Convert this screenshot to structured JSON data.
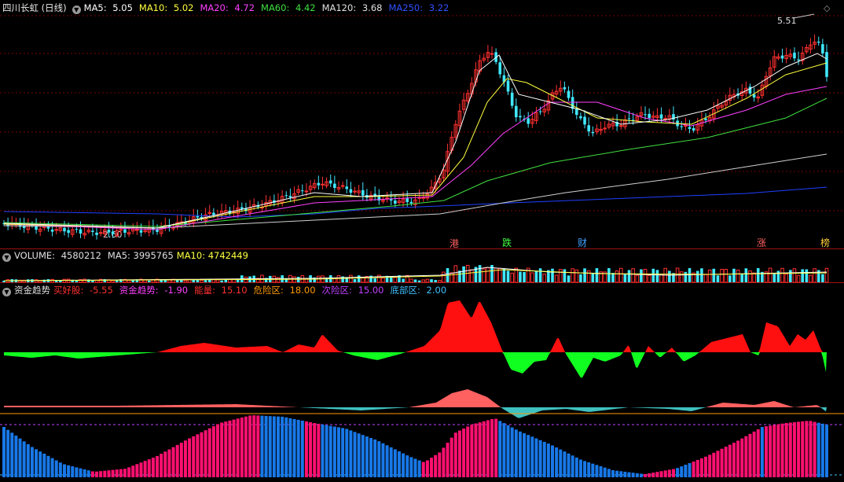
{
  "price_panel": {
    "title": "四川长虹 (日线)",
    "ma5": {
      "label": "MA5: ",
      "value": "5.05",
      "color": "#ffffff"
    },
    "ma10": {
      "label": "MA10: ",
      "value": "5.02",
      "color": "#ffff40"
    },
    "ma20": {
      "label": "MA20: ",
      "value": "4.72",
      "color": "#ff40ff"
    },
    "ma60": {
      "label": "MA60: ",
      "value": "4.42",
      "color": "#40e040"
    },
    "ma120": {
      "label": "MA120: ",
      "value": "3.68",
      "color": "#e0e0e0"
    },
    "ma250": {
      "label": "MA250: ",
      "value": "3.22",
      "color": "#2040ff"
    },
    "high_label": "5.51",
    "low_label": "2.60",
    "markers": [
      {
        "text": "港",
        "color": "#ff6060"
      },
      {
        "text": "跌",
        "color": "#40ff40"
      },
      {
        "text": "财",
        "color": "#40a0ff"
      },
      {
        "text": "涨",
        "color": "#ff6060"
      },
      {
        "text": "榜",
        "color": "#ffd040"
      }
    ]
  },
  "volume_panel": {
    "title": "VOLUME: ",
    "volume": "4580212",
    "ma5": "MA5: 3995765",
    "ma10": "MA10: 4742449"
  },
  "fund_panel": {
    "title": "资金趋势",
    "buy": {
      "label": "买好股: ",
      "value": "-5.55",
      "color": "#ff3030"
    },
    "trend": {
      "label": "资金趋势: ",
      "value": "-1.90",
      "color": "#ff40ff"
    },
    "energy": {
      "label": "能量: ",
      "value": "15.10",
      "color": "#ff3030"
    },
    "danger": {
      "label": "危险区: ",
      "value": "18.00",
      "color": "#ff9900"
    },
    "sub_danger": {
      "label": "次险区: ",
      "value": "15.00",
      "color": "#c040ff"
    },
    "bottom": {
      "label": "底部区: ",
      "value": "2.00",
      "color": "#40c0ff"
    }
  },
  "colors": {
    "up": "#ff3030",
    "down": "#40e0ff",
    "panel_sep": "#a01010"
  }
}
